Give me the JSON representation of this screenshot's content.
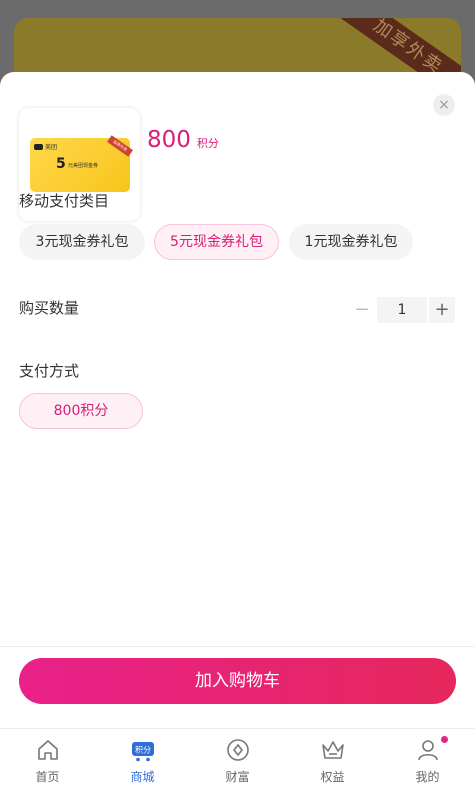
{
  "background": {
    "ribbon_text": "加享外卖"
  },
  "product": {
    "voucher_logo": "美团",
    "voucher_number": "5",
    "voucher_text": "元美团现金券",
    "voucher_badge": "加享外卖",
    "price": "800",
    "price_unit": "积分"
  },
  "close_label": "×",
  "category": {
    "title": "移动支付类目",
    "options": [
      "3元现金券礼包",
      "5元现金券礼包",
      "1元现金券礼包"
    ],
    "selected_index": 1
  },
  "quantity": {
    "title": "购买数量",
    "minus": "−",
    "value": "1",
    "plus": "+"
  },
  "payment": {
    "title": "支付方式",
    "option": "800积分"
  },
  "cart_button": "加入购物车",
  "tabs": [
    {
      "label": "首页",
      "icon": "home-icon"
    },
    {
      "label": "商城",
      "icon": "mall-cart-icon",
      "badge": "积分",
      "active": true
    },
    {
      "label": "财富",
      "icon": "wealth-coin-icon"
    },
    {
      "label": "权益",
      "icon": "crown-icon"
    },
    {
      "label": "我的",
      "icon": "profile-icon",
      "dot": true
    }
  ],
  "colors": {
    "accent": "#d81e78",
    "active_tab": "#2f6ed8",
    "button_start": "#e9218a",
    "button_end": "#e5275c"
  }
}
